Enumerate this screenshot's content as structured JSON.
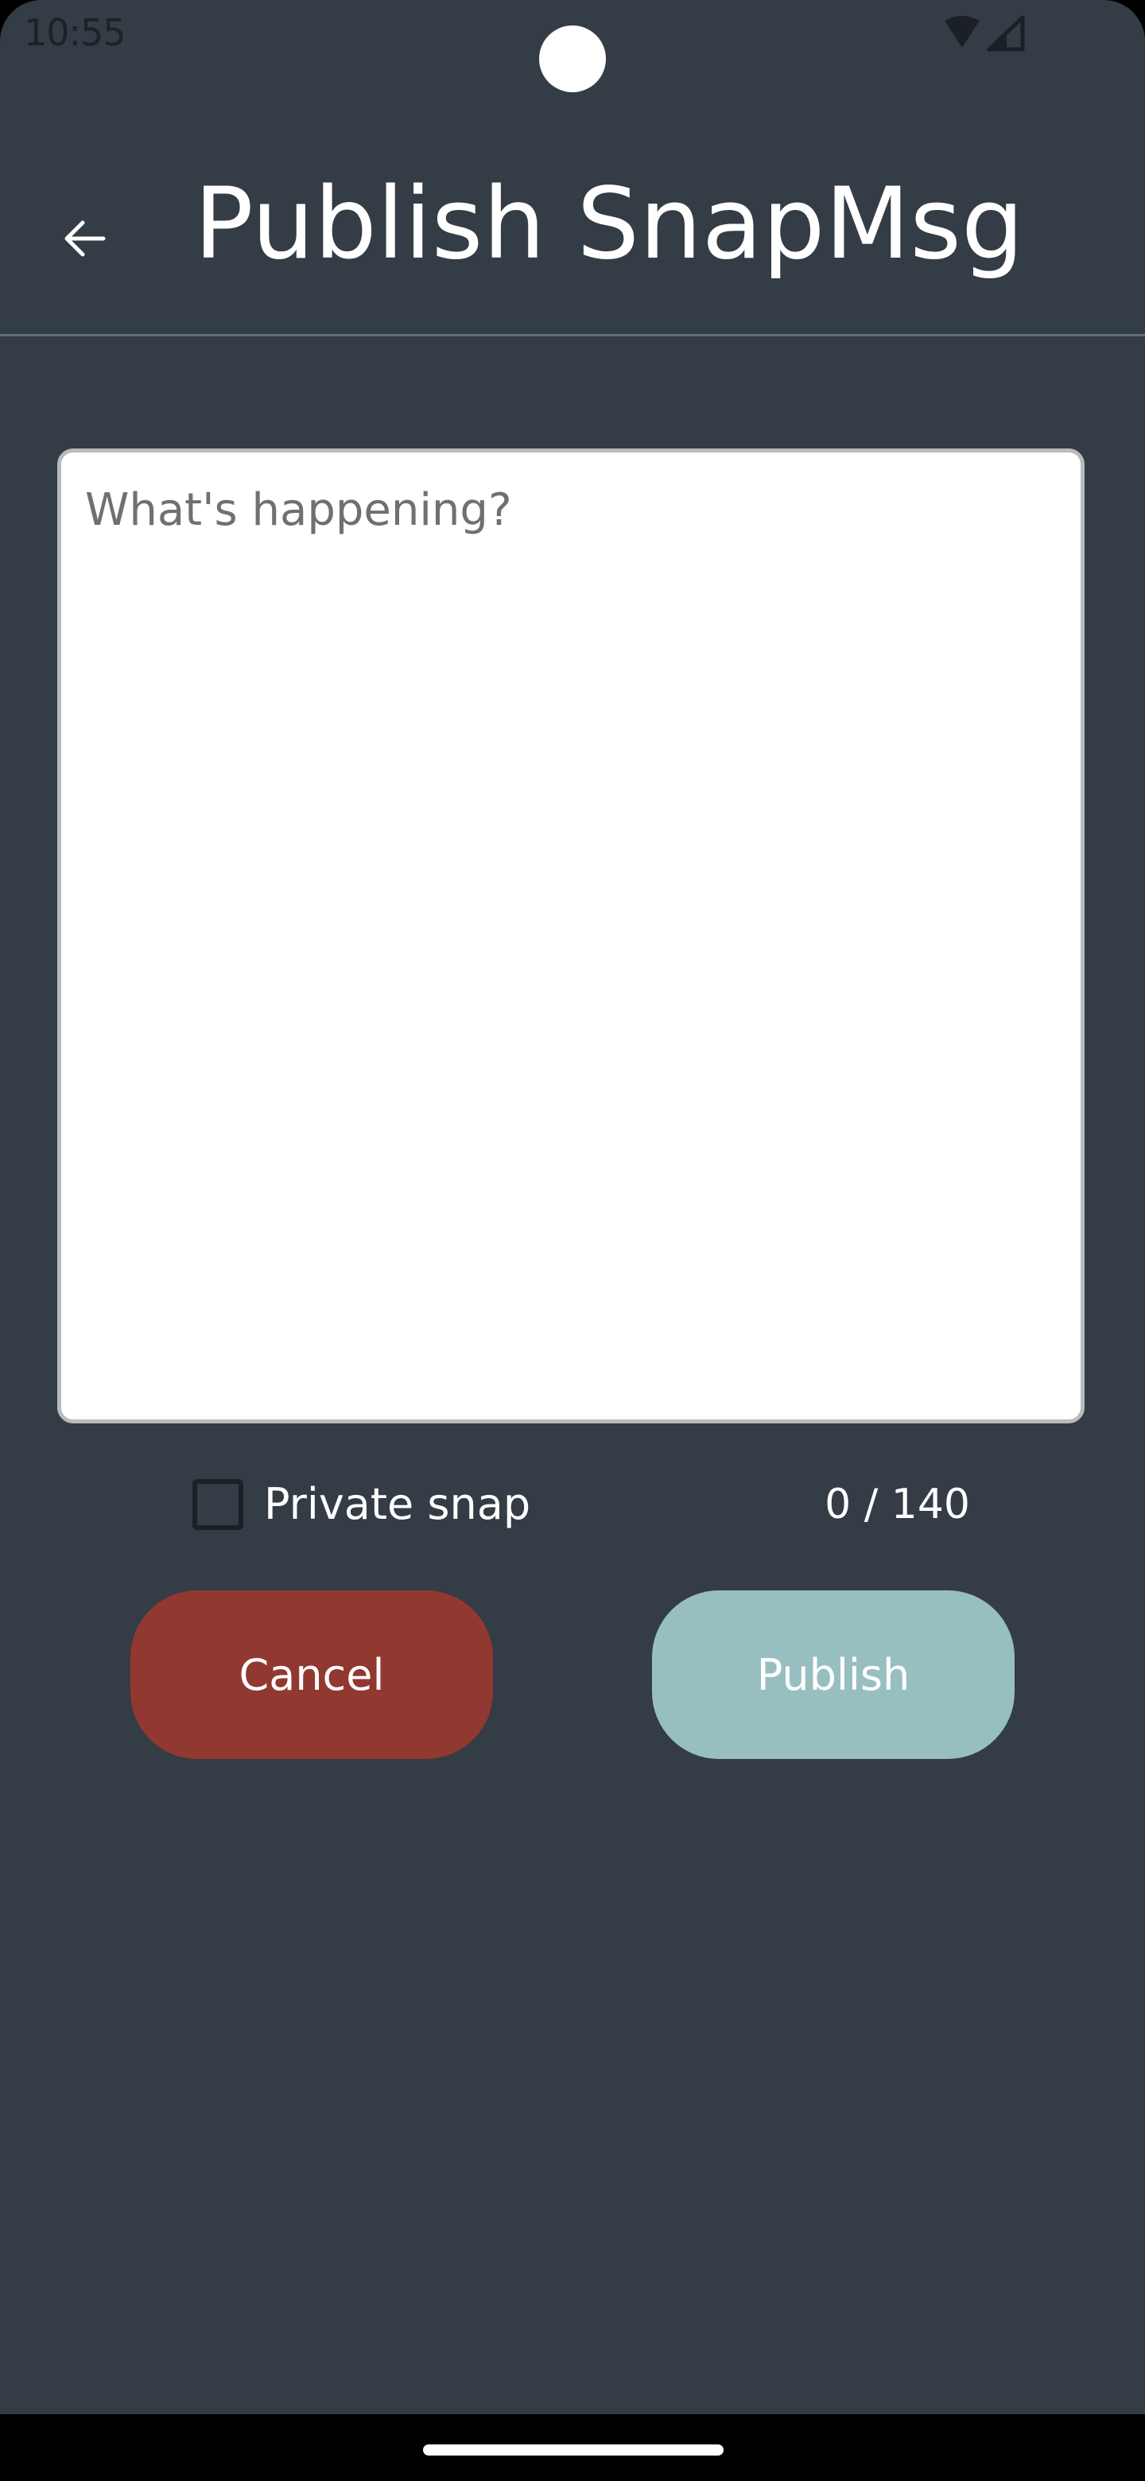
{
  "status_bar": {
    "time": "10:55",
    "wifi_icon": "wifi-icon",
    "signal_icon": "cell-signal-icon"
  },
  "header": {
    "back_icon": "arrow-back-icon",
    "title": "Publish SnapMsg"
  },
  "composer": {
    "value": "",
    "placeholder": "What's happening?"
  },
  "options": {
    "private_label": "Private snap",
    "private_checked": false,
    "counter": "0 / 140"
  },
  "actions": {
    "cancel_label": "Cancel",
    "publish_label": "Publish"
  },
  "colors": {
    "background": "#343c45",
    "cancel": "#913831",
    "publish": "#98bfc0",
    "divider": "#5c707a"
  }
}
